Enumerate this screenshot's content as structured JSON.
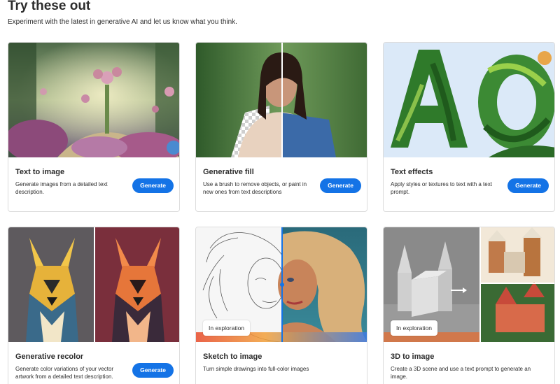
{
  "header": {
    "title": "Try these out",
    "subtitle": "Experiment with the latest in generative AI and let us know what you think."
  },
  "cards": [
    {
      "title": "Text to image",
      "description": "Generate images from a detailed text description.",
      "button": "Generate"
    },
    {
      "title": "Generative fill",
      "description": "Use a brush to remove objects, or paint in new ones from text descriptions",
      "button": "Generate"
    },
    {
      "title": "Text effects",
      "description": "Apply styles or textures to text with a text prompt.",
      "button": "Generate"
    },
    {
      "title": "Generative recolor",
      "description": "Generate color variations of your vector artwork from a detailed text description.",
      "button": "Generate"
    },
    {
      "title": "Sketch to image",
      "description": "Turn simple drawings into full-color images",
      "badge": "In exploration"
    },
    {
      "title": "3D to image",
      "description": "Create a 3D scene and use a text prompt to generate an image.",
      "badge": "In exploration"
    }
  ],
  "colors": {
    "accent": "#1473e6",
    "text": "#2c2c2c",
    "border": "#dcdcdc"
  },
  "effects_letters": "AO"
}
